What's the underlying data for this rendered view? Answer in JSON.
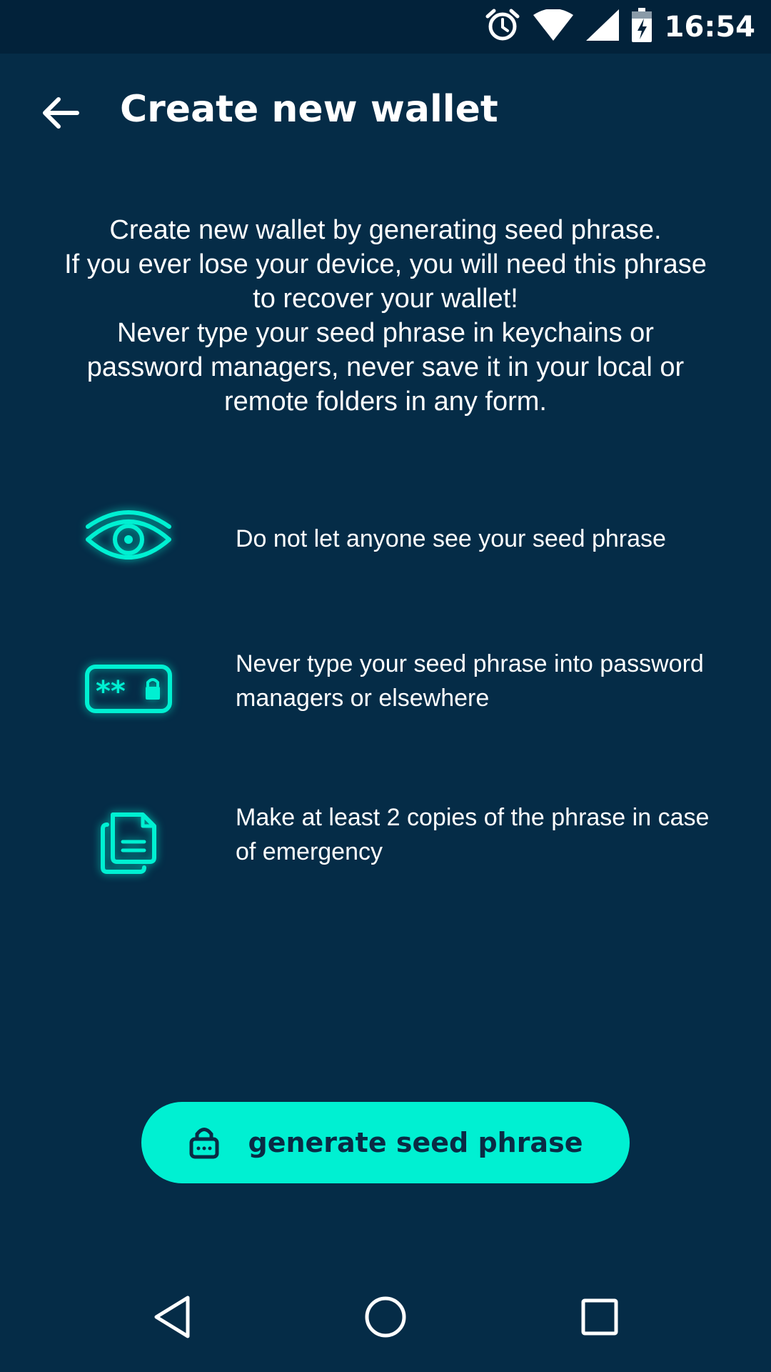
{
  "status_bar": {
    "time": "16:54",
    "icons": [
      "alarm-icon",
      "wifi-icon",
      "cell-signal-icon",
      "battery-charging-icon"
    ]
  },
  "header": {
    "title": "Create new wallet",
    "back_icon": "arrow-left-icon"
  },
  "intro": {
    "lines": [
      "Create new wallet by generating seed phrase.",
      "If you ever lose your device, you will need this phrase to recover your wallet!",
      "Never type your seed phrase in keychains or password managers, never save it in your local or remote folders in any form."
    ]
  },
  "tips": [
    {
      "icon": "eye-icon",
      "text": "Do not let anyone see your seed phrase"
    },
    {
      "icon": "password-lock-icon",
      "text": "Never type your seed phrase into password managers or elsewhere"
    },
    {
      "icon": "documents-copy-icon",
      "text": "Make at least 2 copies of the phrase in case of emergency"
    }
  ],
  "cta": {
    "label": "generate seed phrase",
    "icon": "padlock-icon"
  },
  "nav_bar": {
    "icons": [
      "back-triangle-icon",
      "home-circle-icon",
      "recents-square-icon"
    ]
  },
  "colors": {
    "background": "#052c47",
    "status_bar": "#02223a",
    "accent": "#00f0d2",
    "button_text": "#0a2b44",
    "text": "#ffffff"
  }
}
